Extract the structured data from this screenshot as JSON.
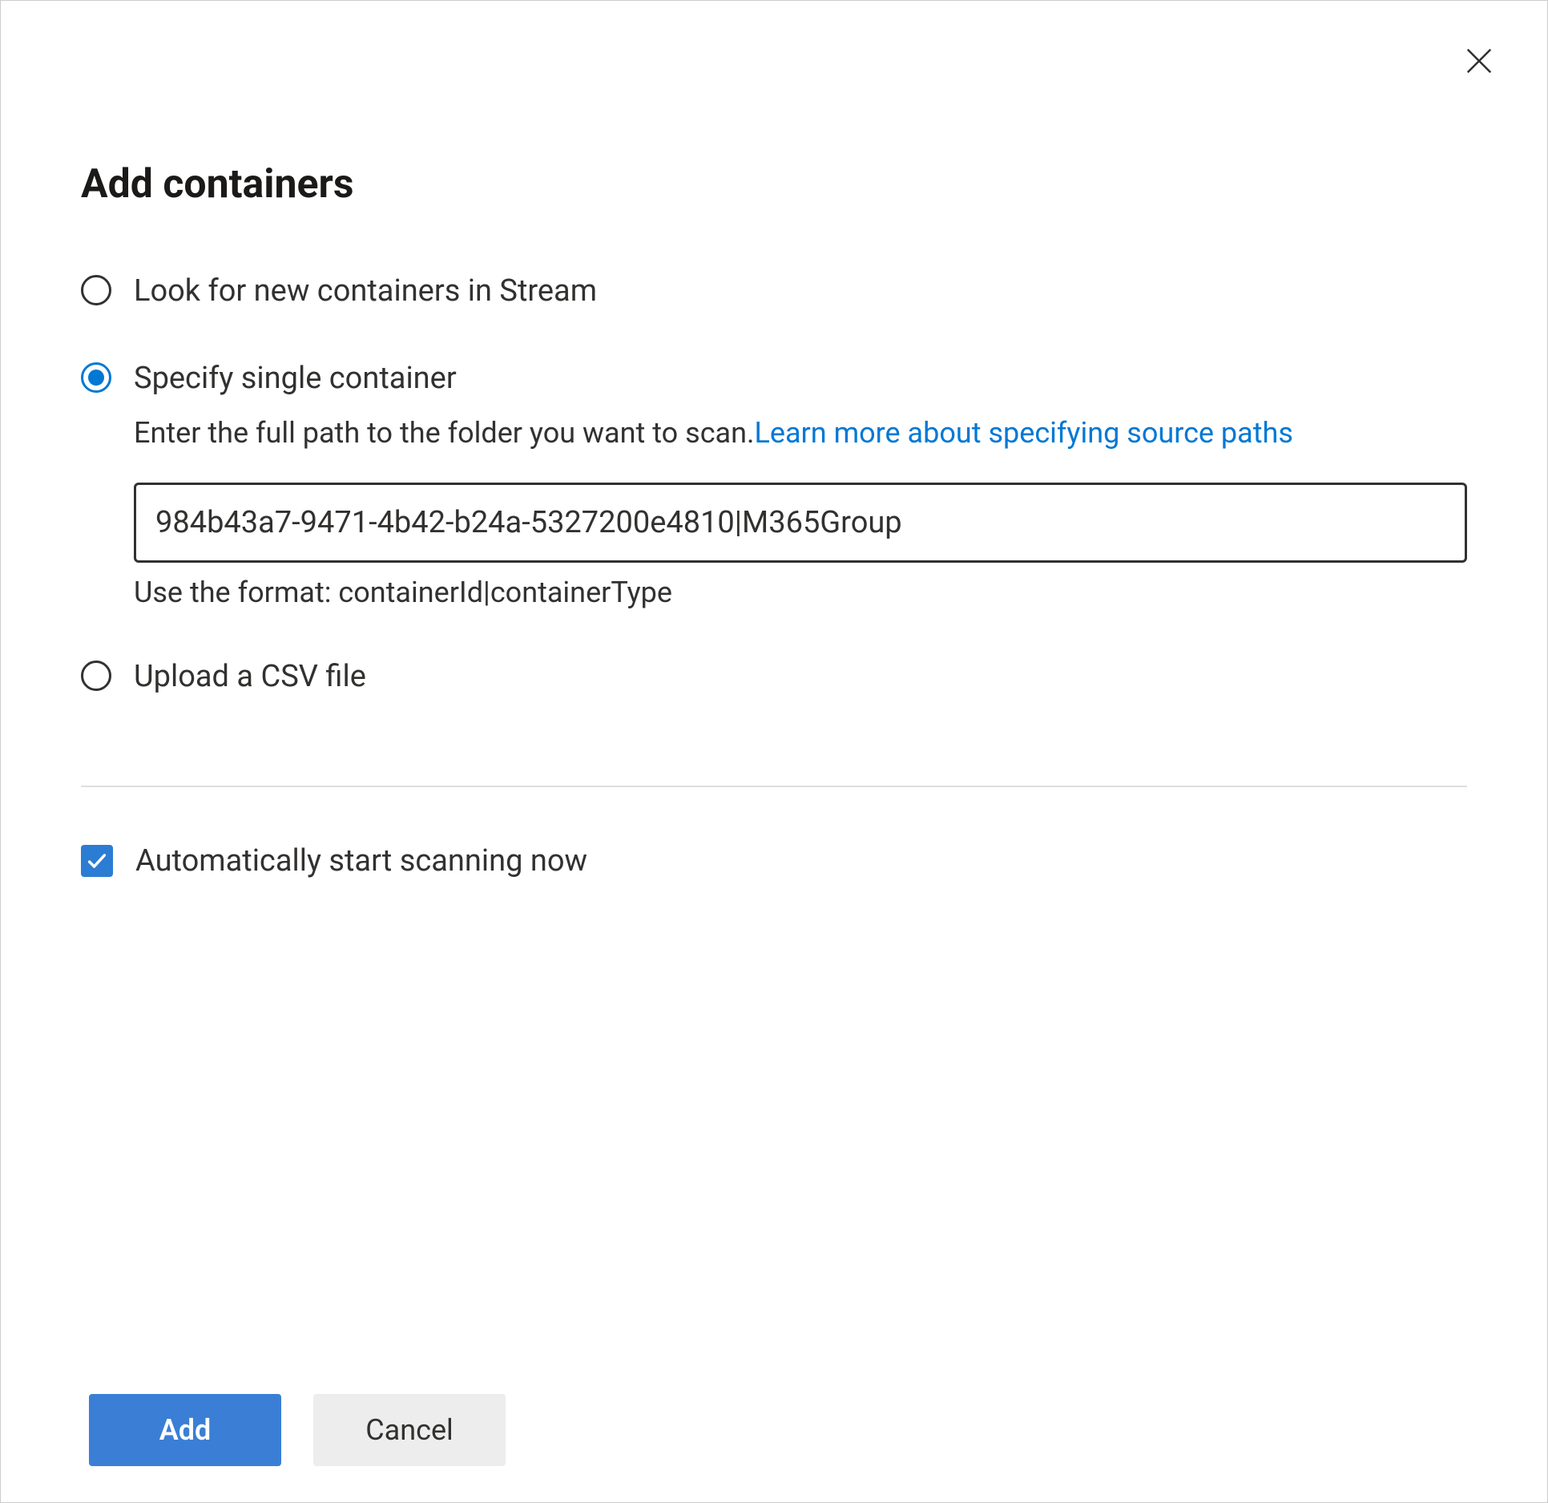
{
  "dialog": {
    "title": "Add containers"
  },
  "options": {
    "lookForNew": {
      "label": "Look for new containers in Stream",
      "selected": false
    },
    "specifySingle": {
      "label": "Specify single container",
      "selected": true,
      "helpPrefix": "Enter the full path to the folder you want to scan.",
      "helpLinkText": "Learn more about specifying source paths",
      "inputValue": "984b43a7-9471-4b42-b24a-5327200e4810|M365Group",
      "inputHint": "Use the format: containerId|containerType"
    },
    "uploadCsv": {
      "label": "Upload a CSV file",
      "selected": false
    }
  },
  "autoScan": {
    "label": "Automatically start scanning now",
    "checked": true
  },
  "footer": {
    "add": "Add",
    "cancel": "Cancel"
  }
}
